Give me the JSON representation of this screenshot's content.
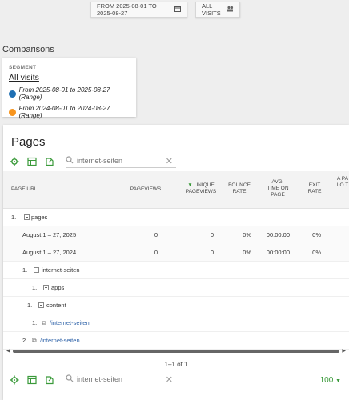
{
  "top": {
    "date_label": "FROM 2025-08-01 TO 2025-08-27",
    "segment_label": "ALL VISITS"
  },
  "comparisons": {
    "title": "Comparisons",
    "segment_heading": "SEGMENT",
    "segment_value": "All visits",
    "ranges": [
      {
        "label": "From 2025-08-01 to 2025-08-27 (Range)",
        "color": "#1f6fb3"
      },
      {
        "label": "From 2024-08-01 to 2024-08-27 (Range)",
        "color": "#f7941d"
      }
    ]
  },
  "panel": {
    "title": "Pages",
    "search_placeholder": "internet-seiten",
    "columns": {
      "url": "PAGE URL",
      "pageviews": "PAGEVIEWS",
      "unique": "UNIQUE PAGEVIEWS",
      "bounce": "BOUNCE RATE",
      "avg": "AVG. TIME ON PAGE",
      "exit": "EXIT RATE",
      "extra": "A PA LO T"
    },
    "rows": [
      {
        "idx": "1.",
        "label": "pages"
      },
      {
        "label": "August 1 – 27, 2025",
        "pageviews": "0",
        "unique": "0",
        "bounce": "0%",
        "avg": "00:00:00",
        "exit": "0%"
      },
      {
        "label": "August 1 – 27, 2024",
        "pageviews": "0",
        "unique": "0",
        "bounce": "0%",
        "avg": "00:00:00",
        "exit": "0%"
      },
      {
        "idx": "1.",
        "label": "internet-seiten"
      },
      {
        "idx": "1.",
        "label": "apps"
      },
      {
        "idx": "1.",
        "label": "content"
      },
      {
        "idx": "1.",
        "label": "/internet-seiten"
      },
      {
        "idx": "2.",
        "label": "/internet-seiten"
      }
    ],
    "pagination": "1–1 of 1",
    "limit": "100"
  },
  "colors": {
    "accent_green": "#3a9a3a",
    "link_blue": "#3366aa"
  }
}
